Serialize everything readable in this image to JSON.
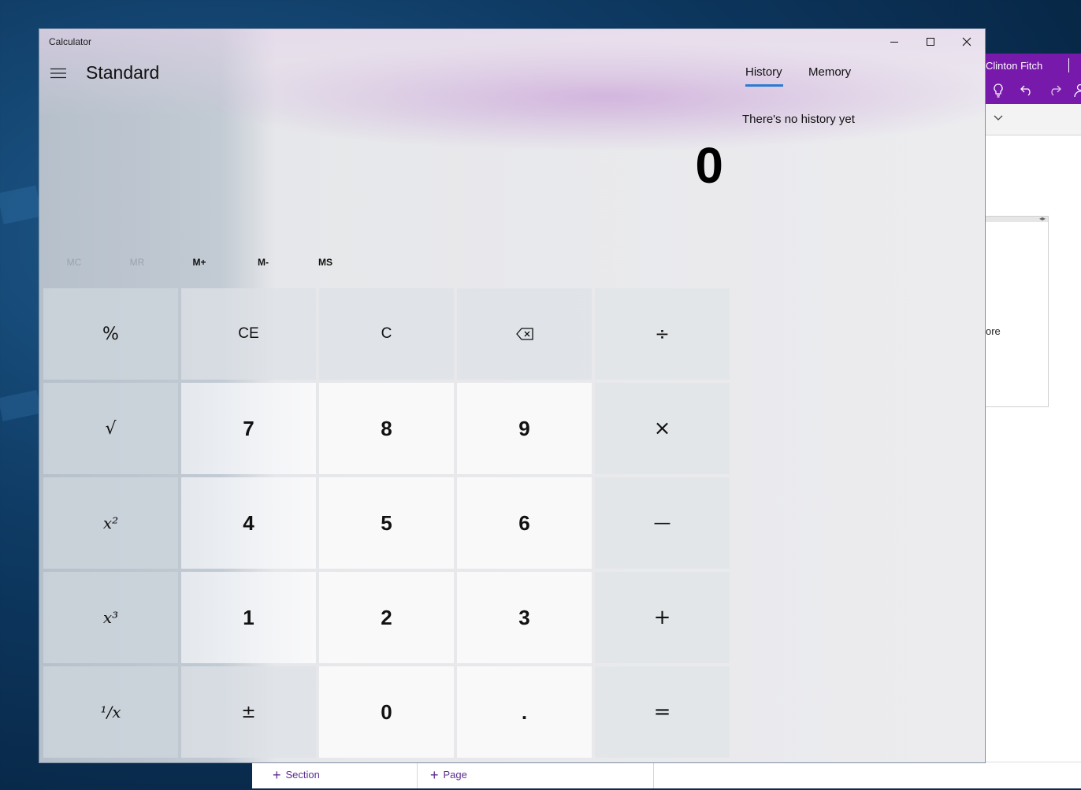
{
  "background_app": {
    "user_name": "Clinton Fitch",
    "partial_text": "ore",
    "add_section_label": "Section",
    "add_page_label": "Page",
    "accent_color": "#7719aa"
  },
  "window": {
    "title": "Calculator"
  },
  "header": {
    "mode_title": "Standard"
  },
  "display": {
    "value": "0"
  },
  "memory": {
    "buttons": [
      {
        "label": "MC",
        "enabled": false
      },
      {
        "label": "MR",
        "enabled": false
      },
      {
        "label": "M+",
        "enabled": true
      },
      {
        "label": "M-",
        "enabled": true
      },
      {
        "label": "MS",
        "enabled": true
      }
    ]
  },
  "keys": {
    "percent": "%",
    "clear_entry": "CE",
    "clear": "C",
    "divide": "÷",
    "sqrt": "√",
    "seven": "7",
    "eight": "8",
    "nine": "9",
    "multiply": "×",
    "square": "x²",
    "four": "4",
    "five": "5",
    "six": "6",
    "minus": "—",
    "cube": "x³",
    "one": "1",
    "two": "2",
    "three": "3",
    "plus": "+",
    "reciprocal": "¹/x",
    "negate": "±",
    "zero": "0",
    "decimal": ".",
    "equals": "="
  },
  "side_panel": {
    "tabs": [
      {
        "label": "History",
        "active": true
      },
      {
        "label": "Memory",
        "active": false
      }
    ],
    "empty_message": "There's no history yet"
  },
  "colors": {
    "tab_underline": "#2b7bd0"
  }
}
